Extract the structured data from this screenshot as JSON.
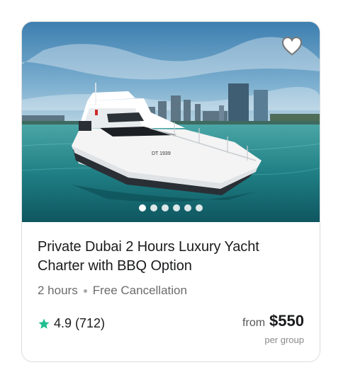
{
  "listing": {
    "title": "Private Dubai 2 Hours Luxury Yacht Charter with BBQ Option",
    "duration": "2 hours",
    "cancellation": "Free Cancellation",
    "rating_value": "4.9",
    "review_count": "(712)",
    "price_prefix": "from",
    "price": "$550",
    "price_unit": "per group",
    "boat_registration": "DT 1939"
  },
  "gallery": {
    "image_count": 6,
    "active_index": 0
  },
  "icons": {
    "favorite": "heart-outline-icon",
    "rating": "star-icon"
  },
  "colors": {
    "star": "#1fbf8f",
    "heart_fill": "#ffffff",
    "heart_stroke": "#777777"
  }
}
